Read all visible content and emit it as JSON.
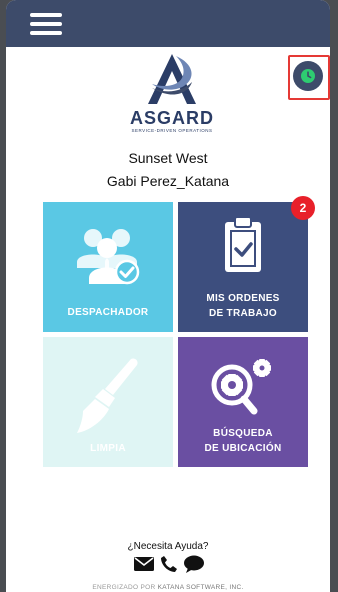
{
  "header": {
    "menu_icon": "hamburger-menu-icon",
    "sync_icon": "clock-icon"
  },
  "brand": {
    "name": "ASGARD",
    "tagline": "SERVICE-DRIVEN OPERATIONS"
  },
  "site_name": "Sunset West",
  "user_name": "Gabi Perez_Katana",
  "tiles": [
    {
      "label": "DESPACHADOR",
      "icon": "people-check-icon",
      "color": "#5ac8e4"
    },
    {
      "label_line1": "MIS ORDENES",
      "label_line2": "DE TRABAJO",
      "icon": "clipboard-check-icon",
      "badge": "2",
      "color": "#3d4e7e"
    },
    {
      "label": "LIMPIA",
      "icon": "broom-icon",
      "color": "#dff5f4"
    },
    {
      "label_line1": "BÚSQUEDA",
      "label_line2": "DE UBICACIÓN",
      "icon": "gears-search-icon",
      "color": "#6a4fa2"
    }
  ],
  "help": {
    "title": "¿Necesita Ayuda?",
    "icons": [
      "envelope-icon",
      "phone-icon",
      "chat-icon"
    ]
  },
  "footer": {
    "prefix": "ENERGIZADO POR",
    "company": "KATANA SOFTWARE, INC."
  }
}
